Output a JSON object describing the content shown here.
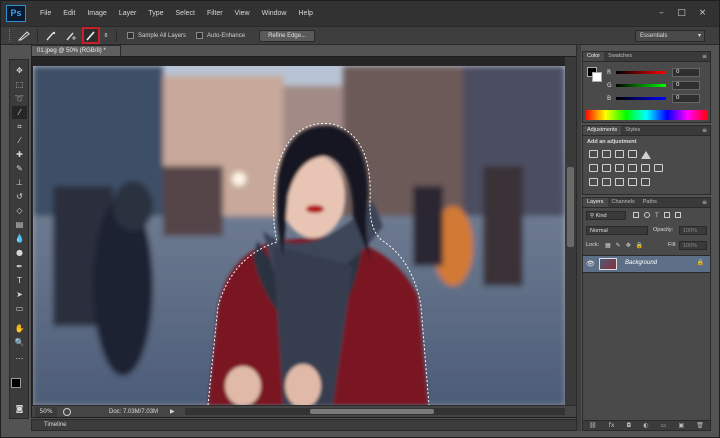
{
  "app": {
    "logo": "Ps"
  },
  "menu": [
    "File",
    "Edit",
    "Image",
    "Layer",
    "Type",
    "Select",
    "Filter",
    "View",
    "Window",
    "Help"
  ],
  "window_controls": {
    "minimize": "–",
    "maximize": "□",
    "close": "×"
  },
  "options": {
    "sample_all_layers": "Sample All Layers",
    "auto_enhance": "Auto-Enhance",
    "refine_edge": "Refine Edge...",
    "workspace": "Essentials",
    "brush_size": "8"
  },
  "document": {
    "tab": "01.jpeg @ 50% (RGB/8) *",
    "zoom": "50%",
    "doc_info": "Doc: 7.03M/7.03M"
  },
  "timeline": {
    "label": "Timeline"
  },
  "color_panel": {
    "tabs": [
      "Color",
      "Swatches"
    ],
    "channels": [
      {
        "label": "R",
        "value": "0"
      },
      {
        "label": "G",
        "value": "0"
      },
      {
        "label": "B",
        "value": "0"
      }
    ]
  },
  "adjustments_panel": {
    "tabs": [
      "Adjustments",
      "Styles"
    ],
    "heading": "Add an adjustment"
  },
  "layers_panel": {
    "tabs": [
      "Layers",
      "Channels",
      "Paths"
    ],
    "filter": "Kind",
    "blend_mode": "Normal",
    "opacity_label": "Opacity:",
    "opacity_value": "100%",
    "lock_label": "Lock:",
    "fill_label": "Fill:",
    "fill_value": "100%",
    "layer_name": "Background"
  },
  "colors": {
    "accent_red": "#c8202a",
    "selected_layer": "#5d6f87",
    "ps_blue": "#3ea3e6"
  }
}
